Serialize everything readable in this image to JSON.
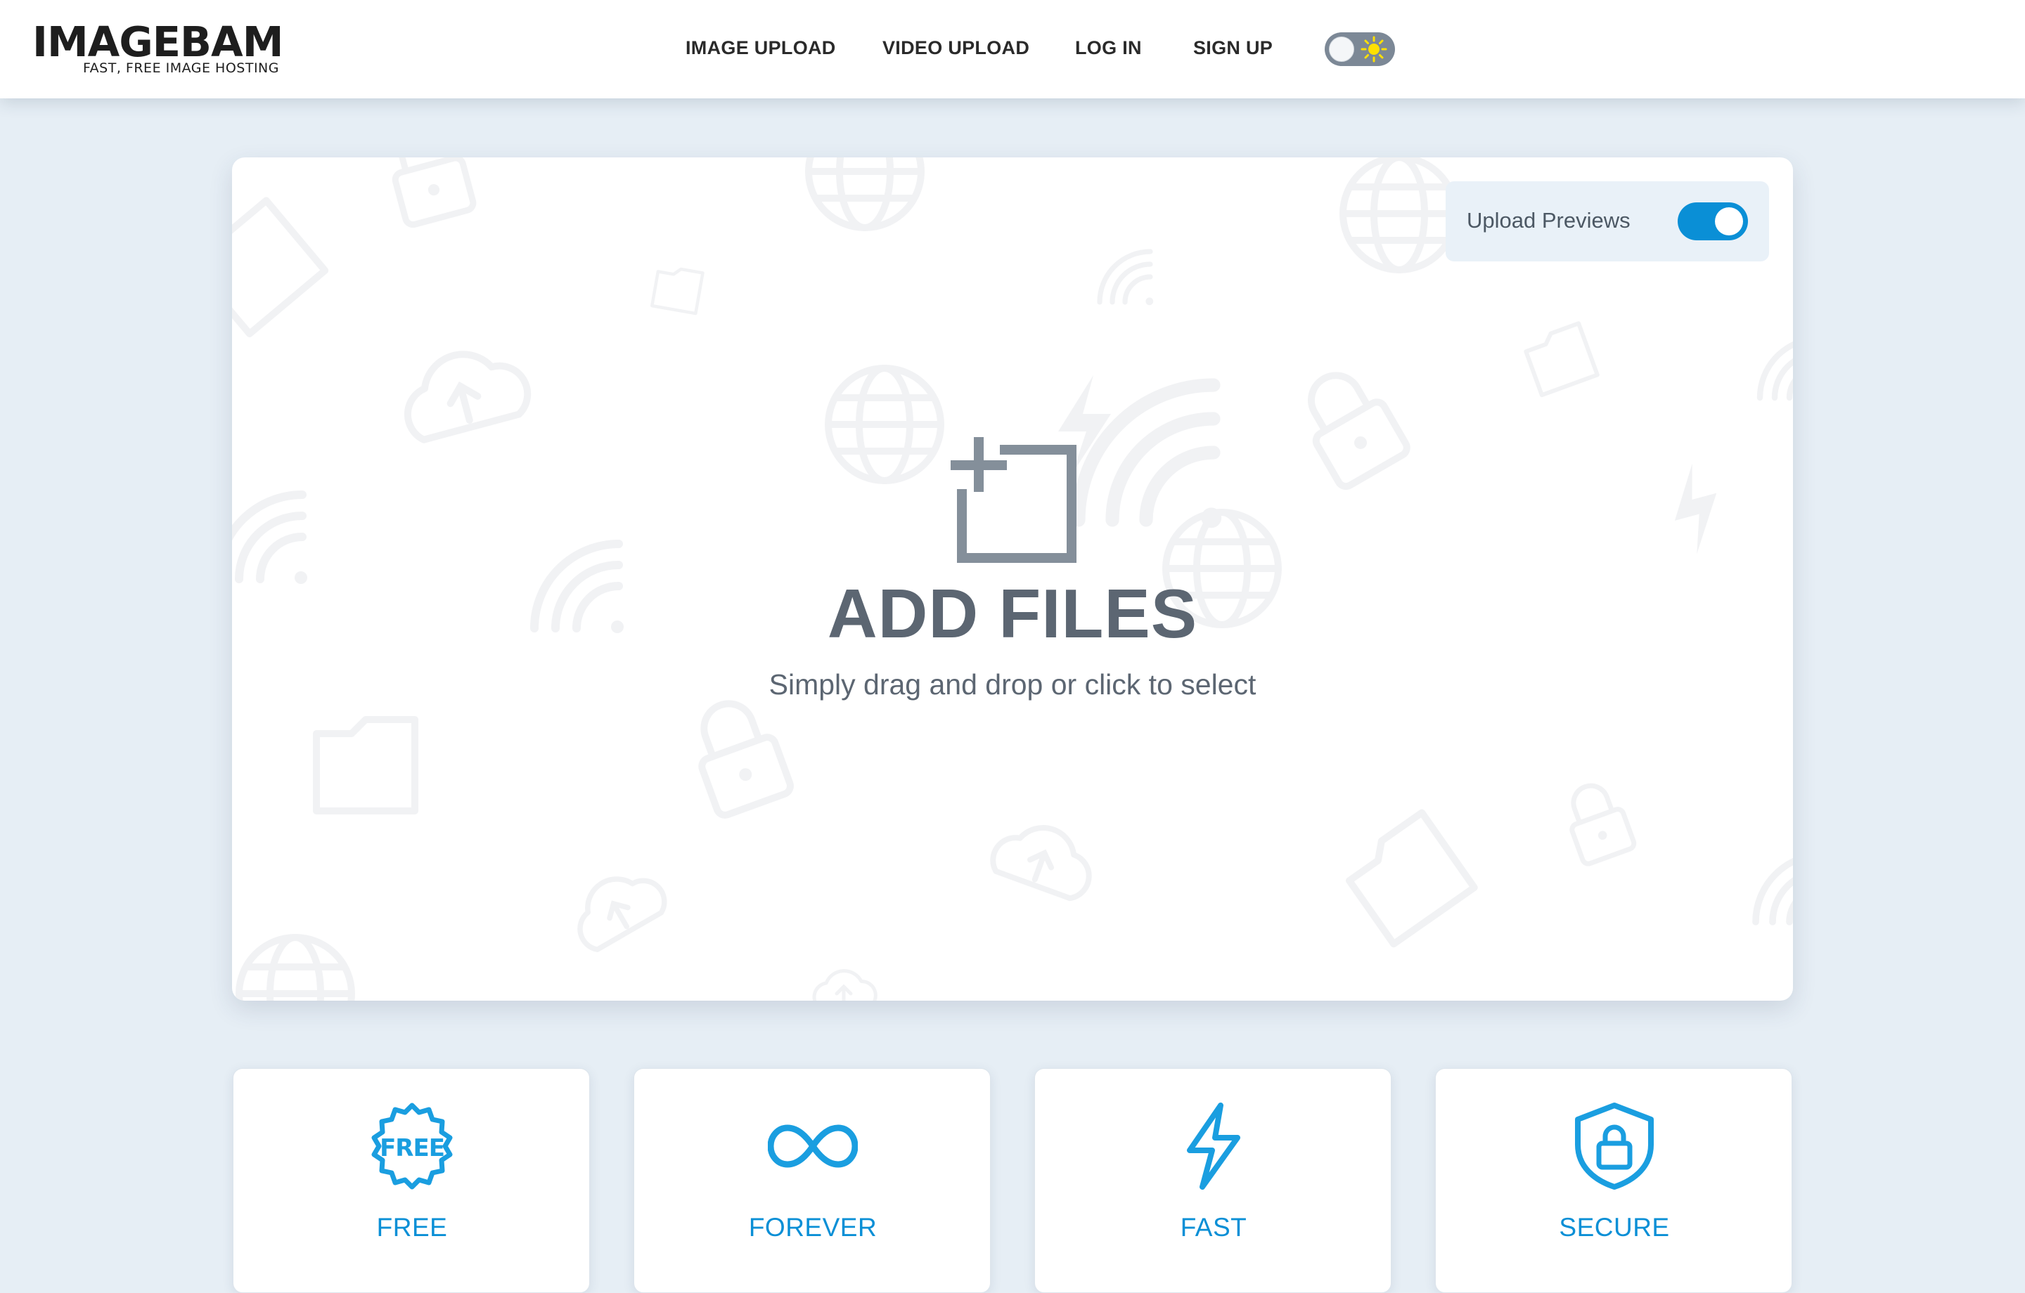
{
  "logo": {
    "title": "IMAGEBAM",
    "tagline": "FAST, FREE IMAGE HOSTING"
  },
  "nav": {
    "items": [
      {
        "label": "IMAGE UPLOAD"
      },
      {
        "label": "VIDEO UPLOAD"
      },
      {
        "label": "LOG IN"
      },
      {
        "label": "SIGN UP"
      }
    ],
    "theme_toggle_icon": "sun-icon",
    "theme_mode": "light"
  },
  "upload": {
    "title": "ADD FILES",
    "subtitle": "Simply drag and drop or click to select",
    "icon": "add-file-icon",
    "previews_label": "Upload Previews",
    "previews_enabled": true
  },
  "features": [
    {
      "label": "FREE",
      "icon": "free-badge-icon"
    },
    {
      "label": "FOREVER",
      "icon": "infinity-icon"
    },
    {
      "label": "FAST",
      "icon": "lightning-icon"
    },
    {
      "label": "SECURE",
      "icon": "shield-lock-icon"
    }
  ],
  "colors": {
    "accent": "#0a8fd6",
    "heading": "#5c6672",
    "page_background": "#e6eef5",
    "toggle_off": "#7c8896",
    "sun": "#ffe000"
  }
}
